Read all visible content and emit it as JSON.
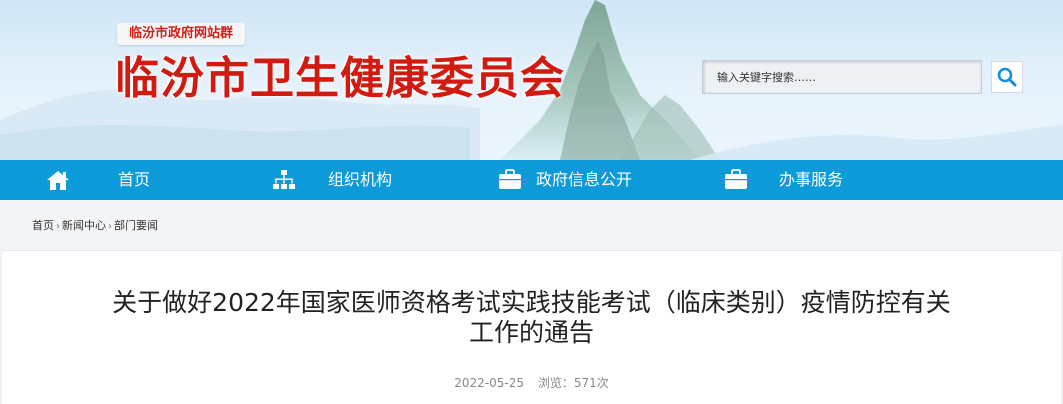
{
  "header": {
    "portal_tag": "临汾市政府网站群",
    "site_title": "临汾市卫生健康委员会"
  },
  "search": {
    "placeholder": "输入关键字搜索……",
    "button_icon": "search-icon"
  },
  "nav": {
    "items": [
      {
        "label": "首页",
        "icon": "home-icon"
      },
      {
        "label": "组织机构",
        "icon": "org-chart-icon"
      },
      {
        "label": "政府信息公开",
        "icon": "briefcase-icon"
      },
      {
        "label": "办事服务",
        "icon": "briefcase-icon"
      }
    ]
  },
  "breadcrumb": [
    "首页",
    "新闻中心",
    "部门要闻"
  ],
  "article": {
    "title_line1": "关于做好2022年国家医师资格考试实践技能考试（临床类别）疫情防控有关",
    "title_line2": "工作的通告",
    "date": "2022-05-25",
    "views_label": "浏览：571次"
  },
  "colors": {
    "nav_bg": "#0d9ad8",
    "title_red": "#d21a10",
    "search_icon_blue": "#1490d6"
  }
}
